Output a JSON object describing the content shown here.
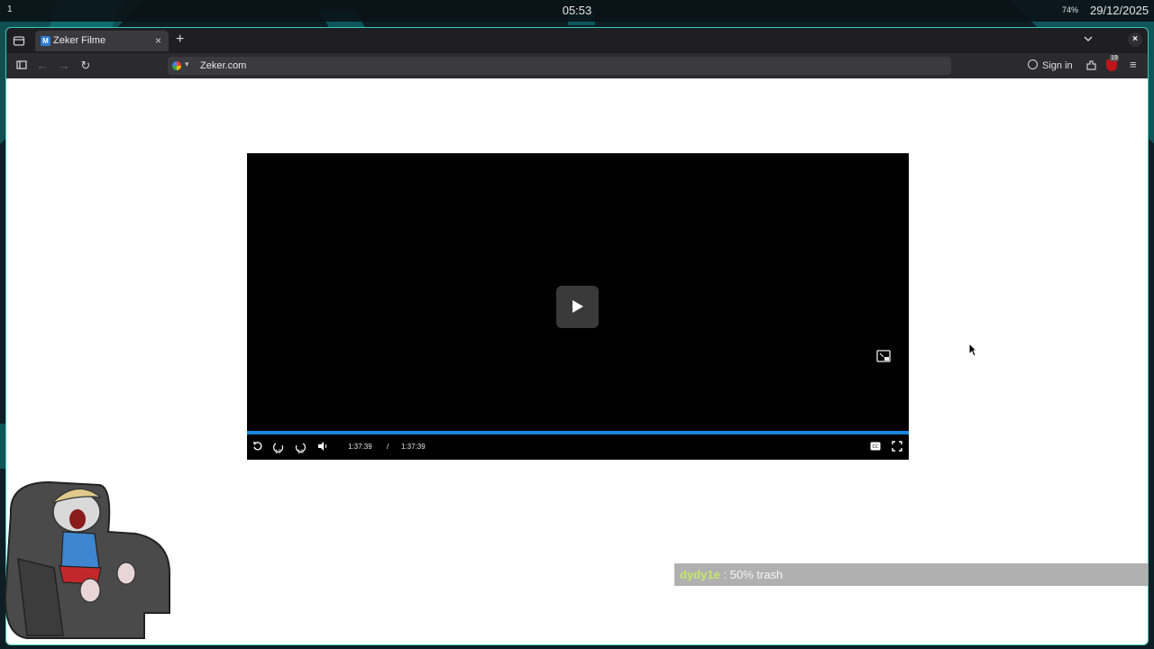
{
  "panel": {
    "workspace": "1",
    "clock": "05:53",
    "battery": "74%",
    "date": "29/12/2025"
  },
  "browser": {
    "tab": {
      "title": "Zeker Filme",
      "favicon": "M"
    },
    "url": "Zeker.com",
    "signin_label": "Sign in",
    "ublock_count": "19",
    "icons": {
      "overview": "tab-overview-icon",
      "new_tab": "+",
      "close_tab": "×",
      "close_window": "×",
      "back": "←",
      "forward": "→",
      "reload": "↻",
      "menu": "≡"
    }
  },
  "player": {
    "current_time": "1:37:39",
    "separator": "/",
    "duration": "1:37:39",
    "progress": 1.0,
    "skip_back_label": "10",
    "skip_forward_label": "10",
    "progress_color": "#1a88e0"
  },
  "chat": {
    "user": "dydy1e",
    "separator": " : ",
    "message": "50% trash"
  }
}
